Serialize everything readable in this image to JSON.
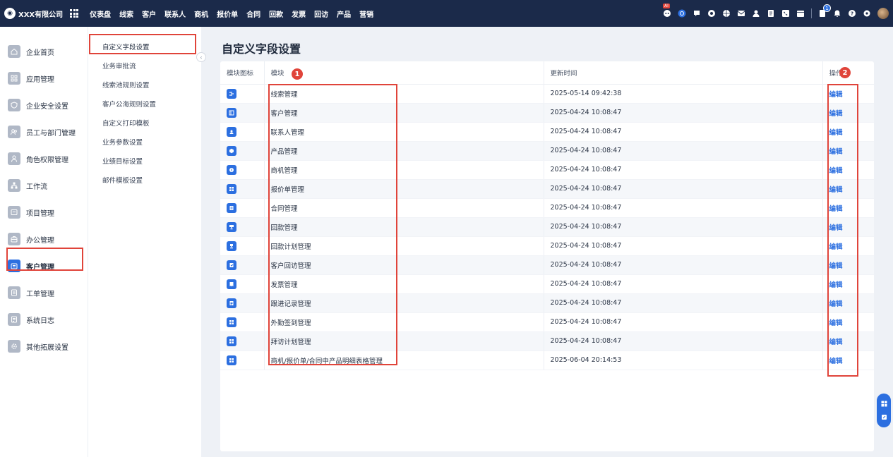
{
  "brand": {
    "name": "XXX有限公司"
  },
  "nav": [
    "仪表盘",
    "线索",
    "客户",
    "联系人",
    "商机",
    "报价单",
    "合同",
    "回款",
    "发票",
    "回访",
    "产品",
    "营销"
  ],
  "topbar": {
    "ai_badge": "AI",
    "notification_count": "1"
  },
  "sidebar": {
    "items": [
      {
        "label": "企业首页",
        "icon": "home-icon"
      },
      {
        "label": "应用管理",
        "icon": "apps-icon"
      },
      {
        "label": "企业安全设置",
        "icon": "shield-icon"
      },
      {
        "label": "员工与部门管理",
        "icon": "users-icon"
      },
      {
        "label": "角色权限管理",
        "icon": "user-role-icon"
      },
      {
        "label": "工作流",
        "icon": "workflow-icon"
      },
      {
        "label": "项目管理",
        "icon": "folder-icon"
      },
      {
        "label": "办公管理",
        "icon": "briefcase-icon"
      },
      {
        "label": "客户管理",
        "icon": "customer-icon"
      },
      {
        "label": "工单管理",
        "icon": "ticket-icon"
      },
      {
        "label": "系统日志",
        "icon": "log-icon"
      },
      {
        "label": "其他拓展设置",
        "icon": "gear-icon"
      }
    ],
    "active_index": 8
  },
  "submenu": {
    "items": [
      "自定义字段设置",
      "业务审批流",
      "线索池规则设置",
      "客户公海规则设置",
      "自定义打印模板",
      "业务参数设置",
      "业绩目标设置",
      "邮件模板设置"
    ],
    "active_index": 0
  },
  "page": {
    "title": "自定义字段设置"
  },
  "table": {
    "headers": {
      "icon": "模块图标",
      "module": "模块",
      "time": "更新时间",
      "op": "操作"
    },
    "edit_label": "编辑",
    "rows": [
      {
        "module": "线索管理",
        "time": "2025-05-14 09:42:38"
      },
      {
        "module": "客户管理",
        "time": "2025-04-24 10:08:47"
      },
      {
        "module": "联系人管理",
        "time": "2025-04-24 10:08:47"
      },
      {
        "module": "产品管理",
        "time": "2025-04-24 10:08:47"
      },
      {
        "module": "商机管理",
        "time": "2025-04-24 10:08:47"
      },
      {
        "module": "报价单管理",
        "time": "2025-04-24 10:08:47"
      },
      {
        "module": "合同管理",
        "time": "2025-04-24 10:08:47"
      },
      {
        "module": "回款管理",
        "time": "2025-04-24 10:08:47"
      },
      {
        "module": "回款计划管理",
        "time": "2025-04-24 10:08:47"
      },
      {
        "module": "客户回访管理",
        "time": "2025-04-24 10:08:47"
      },
      {
        "module": "发票管理",
        "time": "2025-04-24 10:08:47"
      },
      {
        "module": "跟进记录管理",
        "time": "2025-04-24 10:08:47"
      },
      {
        "module": "外勤签到管理",
        "time": "2025-04-24 10:08:47"
      },
      {
        "module": "拜访计划管理",
        "time": "2025-04-24 10:08:47"
      },
      {
        "module": "商机/报价单/合同中产品明细表格管理",
        "time": "2025-06-04 20:14:53"
      }
    ]
  },
  "callouts": [
    "1",
    "2"
  ],
  "colors": {
    "accent": "#2c6fe0",
    "topbar": "#1b2a4a",
    "highlight": "#e0443a"
  }
}
